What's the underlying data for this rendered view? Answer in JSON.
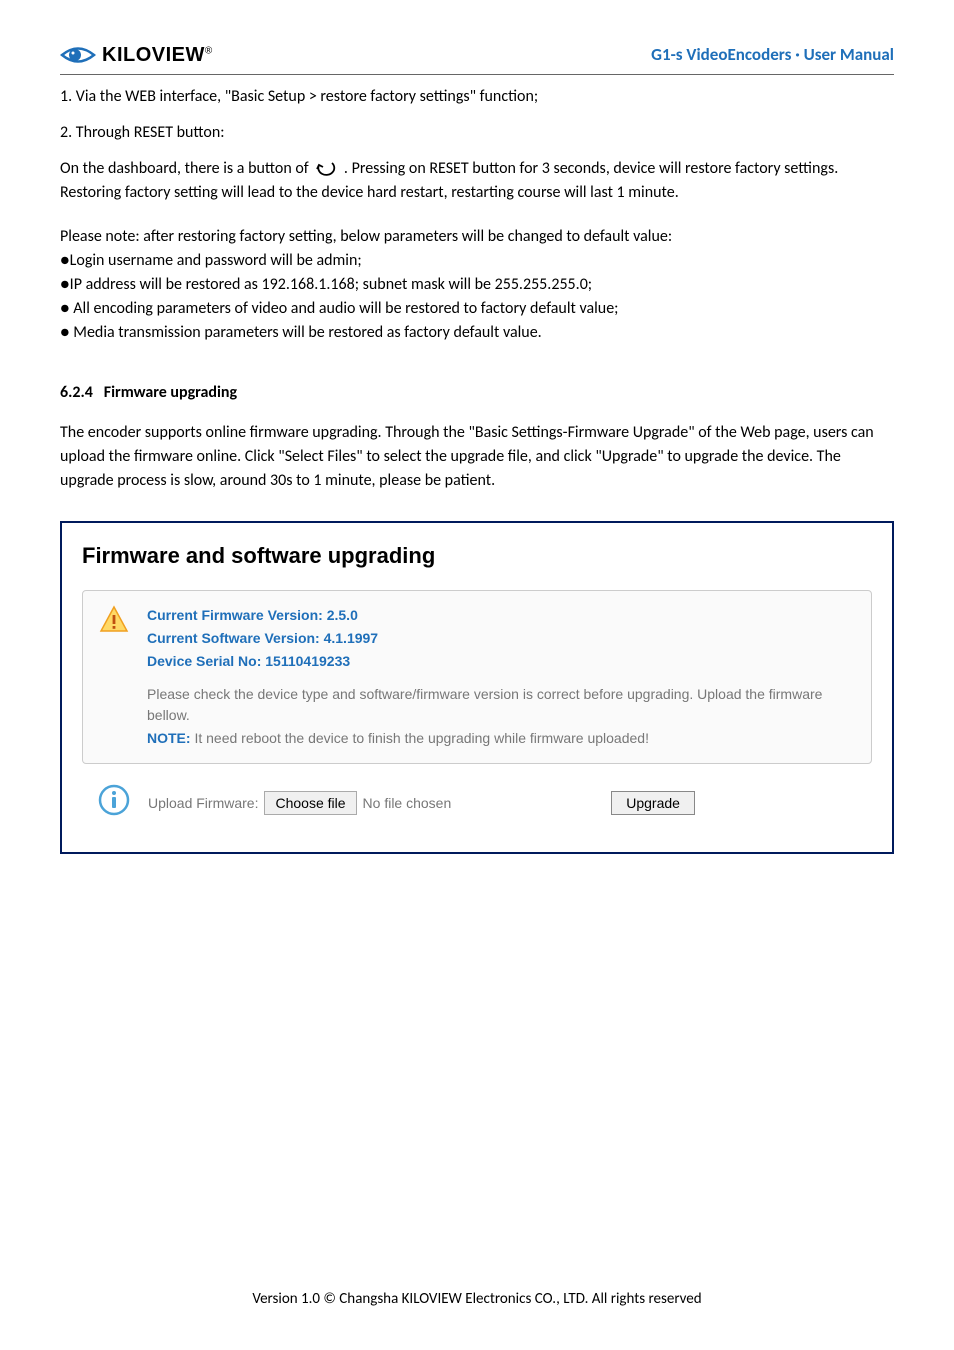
{
  "header": {
    "brand_text": "KILOVIEW",
    "brand_reg": "®",
    "title": "G1-s VideoEncoders · User Manual"
  },
  "body": {
    "line1": "1. Via the WEB interface, \"Basic Setup > restore factory settings\" function;",
    "line2": "2. Through RESET button:",
    "dashboard_pre": "On the dashboard, there is a button of ",
    "dashboard_post": " . Pressing on RESET button for 3 seconds, device will restore factory settings. Restoring factory setting will lead to the device hard restart, restarting course will last 1 minute.",
    "note_intro": "Please note: after restoring factory setting, below parameters will be changed to default value:",
    "bullet1": "●Login username and password will be admin;",
    "bullet2": "●IP address will be restored as 192.168.1.168; subnet mask will be 255.255.255.0;",
    "bullet3": "● All encoding parameters of video and audio will be restored to factory default value;",
    "bullet4": "● Media transmission parameters will be restored as factory default value.",
    "section_num": "6.2.4",
    "section_title": "Firmware upgrading",
    "firmware_para": "The encoder supports online firmware upgrading. Through the \"Basic Settings-Firmware Upgrade\" of the Web page, users can upload the firmware online. Click \"Select Files\" to select the upgrade file, and click \"Upgrade\" to upgrade the device. The upgrade process is slow, around 30s to 1 minute, please be patient."
  },
  "firmware_box": {
    "title": "Firmware and software upgrading",
    "fw_version": "Current Firmware Version: 2.5.0",
    "sw_version": "Current Software Version: 4.1.1997",
    "serial": "Device Serial No: 15110419233",
    "check_text": "Please check the device type and software/firmware version is correct before upgrading. Upload the firmware bellow.",
    "note_label": "NOTE:",
    "note_text": " It need reboot the device to finish the upgrading while firmware uploaded!",
    "upload_label": "Upload Firmware:",
    "choose_file": "Choose file",
    "no_file": "No file chosen",
    "upgrade_btn": "Upgrade"
  },
  "footer": {
    "text": "Version 1.0 © Changsha KILOVIEW Electronics CO., LTD. All rights reserved"
  }
}
